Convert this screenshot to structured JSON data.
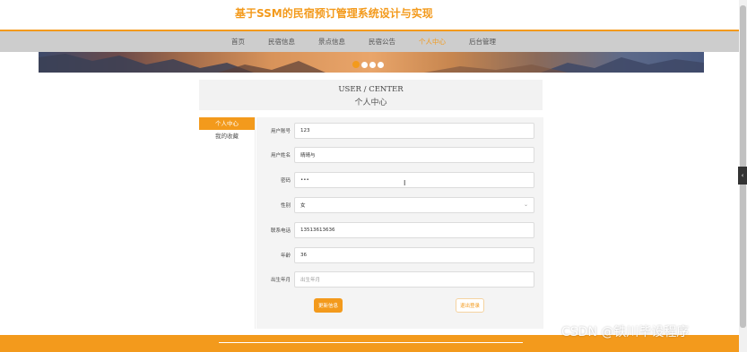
{
  "site": {
    "title": "基于SSM的民宿预订管理系统设计与实现"
  },
  "nav": {
    "items": [
      {
        "label": "首页"
      },
      {
        "label": "民宿信息"
      },
      {
        "label": "景点信息"
      },
      {
        "label": "民宿公告"
      },
      {
        "label": "个人中心"
      },
      {
        "label": "后台管理"
      }
    ],
    "active_index": 4
  },
  "banner": {
    "dots_count": 4,
    "active_dot": 0
  },
  "center": {
    "en": "USER / CENTER",
    "cn": "个人中心"
  },
  "sidebar": {
    "items": [
      {
        "label": "个人中心"
      },
      {
        "label": "我的收藏"
      }
    ],
    "active_index": 0
  },
  "form": {
    "fields": [
      {
        "label": "用户账号",
        "value": "123"
      },
      {
        "label": "用户姓名",
        "value": "晴晴与"
      },
      {
        "label": "密码",
        "value": "•••"
      },
      {
        "label": "性别",
        "value": "女"
      },
      {
        "label": "联系电话",
        "value": "13513613636"
      },
      {
        "label": "年龄",
        "value": "36"
      },
      {
        "label": "出生年月",
        "placeholder": "出生年月"
      }
    ],
    "save_label": "更新信息",
    "logout_label": "退出登录"
  },
  "side_tab": {
    "glyph": "‹"
  },
  "cursor": {
    "glyph": "I"
  },
  "watermark": {
    "text": "CSDN @铁川毕设程序"
  },
  "colors": {
    "accent": "#f39a1c",
    "nav_bg": "#cdcdcd"
  }
}
